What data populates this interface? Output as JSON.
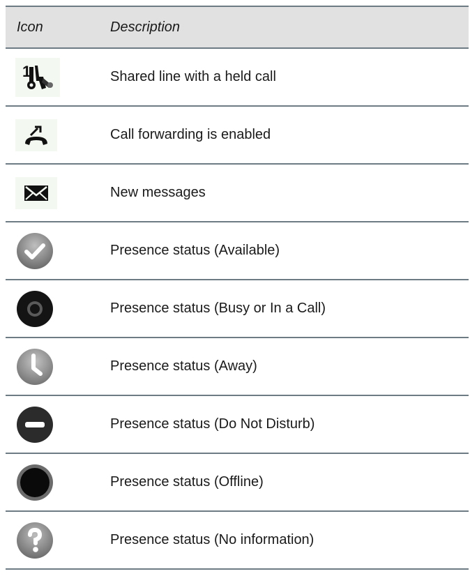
{
  "header": {
    "col_icon": "Icon",
    "col_description": "Description"
  },
  "rows": [
    {
      "icon": "shared-line-held-call-icon",
      "description": "Shared line with a held call"
    },
    {
      "icon": "call-forwarding-icon",
      "description": "Call forwarding is enabled"
    },
    {
      "icon": "new-messages-icon",
      "description": "New messages"
    },
    {
      "icon": "presence-available-icon",
      "description": "Presence status (Available)"
    },
    {
      "icon": "presence-busy-icon",
      "description": "Presence status (Busy or In a Call)"
    },
    {
      "icon": "presence-away-icon",
      "description": "Presence status (Away)"
    },
    {
      "icon": "presence-dnd-icon",
      "description": "Presence status (Do Not Disturb)"
    },
    {
      "icon": "presence-offline-icon",
      "description": "Presence status (Offline)"
    },
    {
      "icon": "presence-no-info-icon",
      "description": "Presence status (No information)"
    }
  ],
  "icon_overlay_text": {
    "shared_line_number": "1"
  }
}
